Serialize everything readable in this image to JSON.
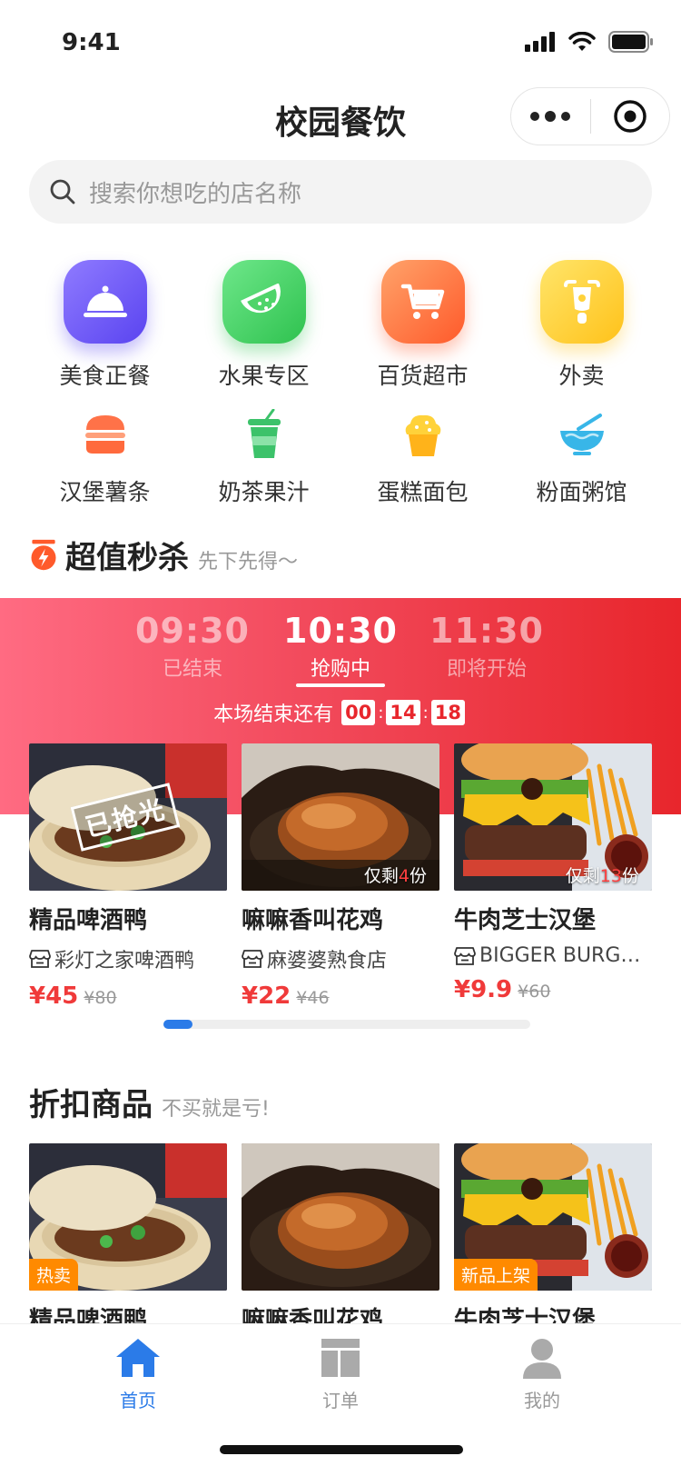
{
  "status_bar": {
    "time": "9:41"
  },
  "nav": {
    "title": "校园餐饮"
  },
  "search": {
    "placeholder": "搜索你想吃的店名称"
  },
  "categories_main": [
    {
      "label": "美食正餐",
      "icon": "dining-cloche-icon"
    },
    {
      "label": "水果专区",
      "icon": "watermelon-icon"
    },
    {
      "label": "百货超市",
      "icon": "shopping-cart-icon"
    },
    {
      "label": "外卖",
      "icon": "scooter-icon"
    }
  ],
  "categories_sub": [
    {
      "label": "汉堡薯条",
      "icon": "burger-icon"
    },
    {
      "label": "奶茶果汁",
      "icon": "drink-cup-icon"
    },
    {
      "label": "蛋糕面包",
      "icon": "cupcake-icon"
    },
    {
      "label": "粉面粥馆",
      "icon": "bowl-icon"
    }
  ],
  "flash_sale": {
    "title": "超值秒杀",
    "subtitle": "先下先得～",
    "slots": [
      {
        "time": "09:30",
        "status": "已结束"
      },
      {
        "time": "10:30",
        "status": "抢购中"
      },
      {
        "time": "11:30",
        "status": "即将开始"
      }
    ],
    "countdown_label": "本场结束还有",
    "countdown": {
      "hh": "00",
      "mm": "14",
      "ss": "18"
    },
    "soldout_stamp": "已抢光",
    "products": [
      {
        "name": "精品啤酒鸭",
        "shop": "彩灯之家啤酒鸭",
        "price": "¥45",
        "old_price": "¥80"
      },
      {
        "name": "嘛嘛香叫花鸡",
        "shop": "麻婆婆熟食店",
        "price": "¥22",
        "old_price": "¥46",
        "remain_prefix": "仅剩",
        "remain_count": "4",
        "remain_suffix": "份"
      },
      {
        "name": "牛肉芝士汉堡",
        "shop": "BIGGER BURG…",
        "price": "¥9.9",
        "old_price": "¥60",
        "remain_prefix": "仅剩",
        "remain_count": "13",
        "remain_suffix": "份"
      }
    ],
    "scroll_progress": 0.08
  },
  "discount": {
    "title": "折扣商品",
    "subtitle": "不买就是亏!",
    "products": [
      {
        "name": "精品啤酒鸭",
        "tag": "热卖"
      },
      {
        "name": "嘛嘛香叫花鸡",
        "tag": ""
      },
      {
        "name": "牛肉芝士汉堡",
        "tag": "新品上架"
      }
    ]
  },
  "tabbar": {
    "items": [
      {
        "label": "首页",
        "icon": "home-icon",
        "active": true
      },
      {
        "label": "订单",
        "icon": "orders-icon",
        "active": false
      },
      {
        "label": "我的",
        "icon": "profile-icon",
        "active": false
      }
    ]
  },
  "colors": {
    "accent": "#2b7be8",
    "price": "#f03a3a",
    "flash_gradient_start": "#ff6b82",
    "flash_gradient_end": "#e8262c",
    "tag": "#ff8a00"
  }
}
